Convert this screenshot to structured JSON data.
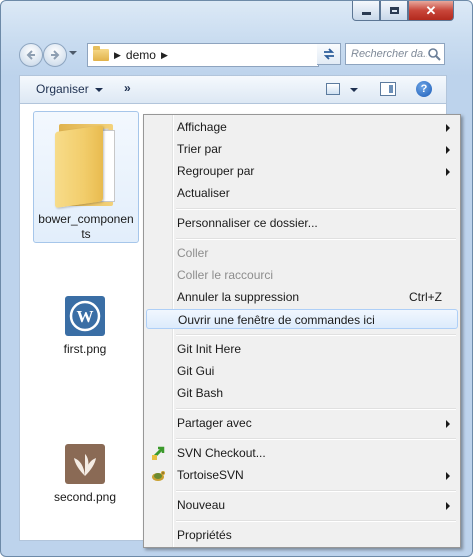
{
  "window": {
    "close_glyph": "✕"
  },
  "navbar": {
    "address_folder": "demo",
    "search_placeholder": "Rechercher da..."
  },
  "toolbar": {
    "organize_label": "Organiser",
    "more_label": "»"
  },
  "files": [
    {
      "label": "bower_components",
      "icon": "folder-icon",
      "selected": true
    },
    {
      "label": "first.png",
      "icon": "wordpress-logo-icon"
    },
    {
      "label": "second.png",
      "icon": "leaf-logo-icon"
    }
  ],
  "context_menu": {
    "items": [
      {
        "label": "Affichage",
        "submenu": true
      },
      {
        "label": "Trier par",
        "submenu": true
      },
      {
        "label": "Regrouper par",
        "submenu": true
      },
      {
        "label": "Actualiser"
      },
      {
        "label": "Personnaliser ce dossier..."
      },
      {
        "label": "Coller",
        "disabled": true
      },
      {
        "label": "Coller le raccourci",
        "disabled": true
      },
      {
        "label": "Annuler la suppression",
        "shortcut": "Ctrl+Z"
      },
      {
        "label": "Ouvrir une fenêtre de commandes ici",
        "highlighted": true
      },
      {
        "label": "Git Init Here"
      },
      {
        "label": "Git Gui"
      },
      {
        "label": "Git Bash"
      },
      {
        "label": "Partager avec",
        "submenu": true
      },
      {
        "label": "SVN Checkout...",
        "icon": "svn-checkout-icon"
      },
      {
        "label": "TortoiseSVN",
        "submenu": true,
        "icon": "tortoise-icon"
      },
      {
        "label": "Nouveau",
        "submenu": true
      },
      {
        "label": "Propriétés"
      }
    ]
  },
  "colors": {
    "wordpress_tile": "#3a6ea5",
    "leaf_tile": "#8a6a55",
    "menu_highlight": "#dcebfc"
  }
}
